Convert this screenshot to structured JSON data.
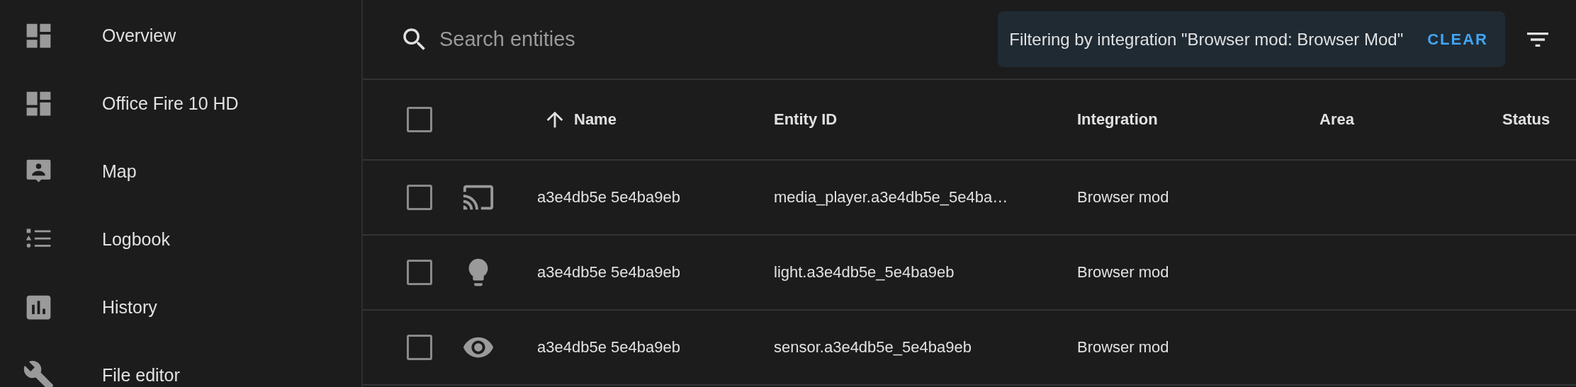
{
  "sidebar": {
    "items": [
      {
        "label": "Overview"
      },
      {
        "label": "Office Fire 10 HD"
      },
      {
        "label": "Map"
      },
      {
        "label": "Logbook"
      },
      {
        "label": "History"
      },
      {
        "label": "File editor"
      }
    ]
  },
  "search": {
    "placeholder": "Search entities"
  },
  "filter": {
    "text": "Filtering by integration \"Browser mod: Browser Mod\"",
    "action": "CLEAR"
  },
  "table": {
    "select_all": {
      "checked": false
    },
    "columns": [
      {
        "label": "Name",
        "sorted": true
      },
      {
        "label": "Entity ID",
        "sorted": false
      },
      {
        "label": "Integration",
        "sorted": false
      },
      {
        "label": "Area",
        "sorted": false
      },
      {
        "label": "Status",
        "sorted": false
      }
    ],
    "rows": [
      {
        "checked": false,
        "name": "a3e4db5e 5e4ba9eb",
        "entity_id": "media_player.a3e4db5e_5e4ba…",
        "integration": "Browser mod"
      },
      {
        "checked": false,
        "name": "a3e4db5e 5e4ba9eb",
        "entity_id": "light.a3e4db5e_5e4ba9eb",
        "integration": "Browser mod"
      },
      {
        "checked": false,
        "name": "a3e4db5e 5e4ba9eb",
        "entity_id": "sensor.a3e4db5e_5e4ba9eb",
        "integration": "Browser mod"
      }
    ]
  }
}
